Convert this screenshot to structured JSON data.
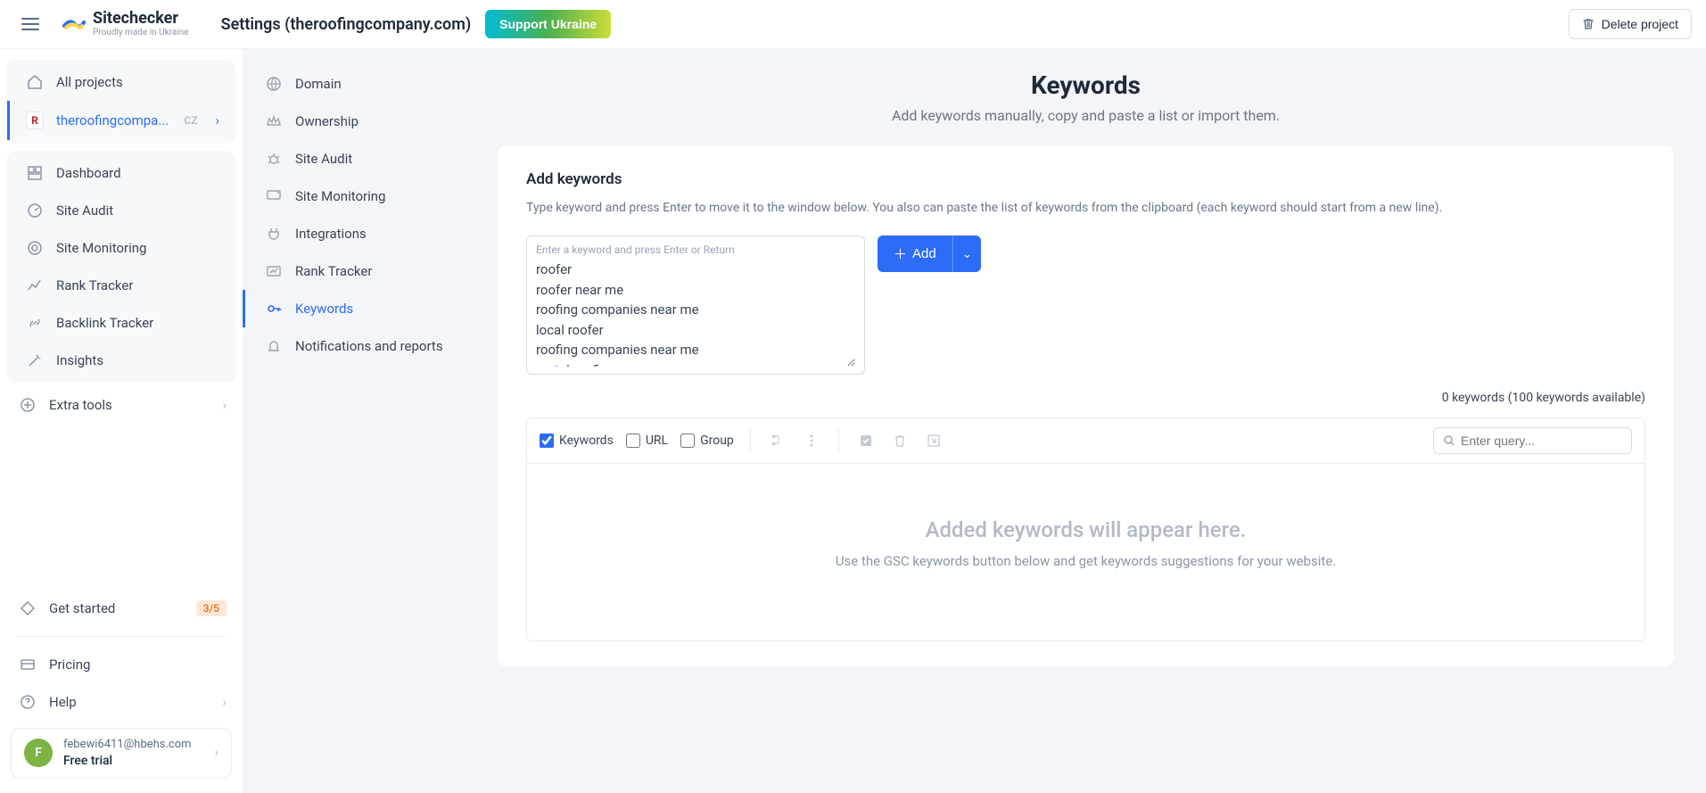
{
  "header": {
    "logo_name": "Sitechecker",
    "logo_tagline": "Proudly made in Ukraine",
    "page_title": "Settings (theroofingcompany.com)",
    "support_label": "Support Ukraine",
    "delete_label": "Delete project"
  },
  "sidebar": {
    "all_projects": "All projects",
    "project_name": "theroofingcompa...",
    "project_letter": "R",
    "project_locale": "CZ",
    "items": [
      {
        "label": "Dashboard"
      },
      {
        "label": "Site Audit"
      },
      {
        "label": "Site Monitoring"
      },
      {
        "label": "Rank Tracker"
      },
      {
        "label": "Backlink Tracker"
      },
      {
        "label": "Insights"
      }
    ],
    "extra_tools": "Extra tools",
    "get_started": "Get started",
    "get_started_count": "3/5",
    "pricing": "Pricing",
    "help": "Help"
  },
  "user": {
    "avatar_letter": "F",
    "email": "febewi6411@hbehs.com",
    "plan": "Free trial"
  },
  "settings_nav": {
    "items": [
      {
        "label": "Domain"
      },
      {
        "label": "Ownership"
      },
      {
        "label": "Site Audit"
      },
      {
        "label": "Site Monitoring"
      },
      {
        "label": "Integrations"
      },
      {
        "label": "Rank Tracker"
      },
      {
        "label": "Keywords",
        "active": true
      },
      {
        "label": "Notifications and reports"
      }
    ]
  },
  "main": {
    "title": "Keywords",
    "subtitle": "Add keywords manually, copy and paste a list or import them.",
    "section_title": "Add keywords",
    "section_desc": "Type keyword and press Enter to move it to the window below. You also can paste the list of keywords from the clipboard (each keyword should start from a new line).",
    "textarea_label": "Enter a keyword and press Enter or Return",
    "textarea_value": "roofer\nroofer near me\nroofing companies near me\nlocal roofer\nroofing companies near me\nmetal roofing\nroofing contractor",
    "add_label": "Add",
    "kw_counter": "0 keywords (100 keywords available)",
    "toolbar": {
      "keywords": "Keywords",
      "url": "URL",
      "group": "Group",
      "search_placeholder": "Enter query..."
    },
    "empty_title": "Added keywords will appear here.",
    "empty_sub": "Use the GSC keywords button below and get keywords suggestions for your website."
  }
}
